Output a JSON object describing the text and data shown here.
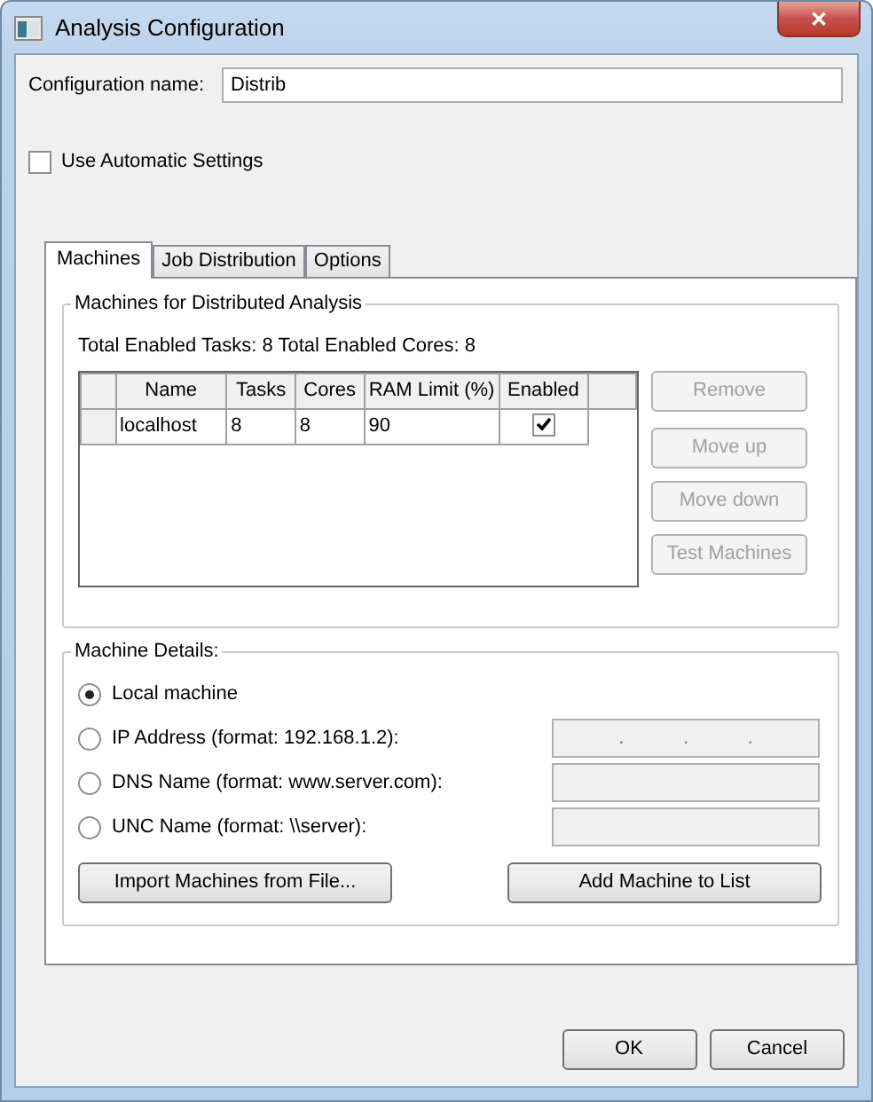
{
  "window": {
    "title": "Analysis Configuration",
    "close": "✕"
  },
  "config_name": {
    "label": "Configuration name:",
    "value": "Distrib"
  },
  "auto_settings": {
    "label": "Use Automatic Settings",
    "checked": false
  },
  "tabs": [
    {
      "label": "Machines",
      "selected": true
    },
    {
      "label": "Job Distribution",
      "selected": false
    },
    {
      "label": "Options",
      "selected": false
    }
  ],
  "machines_group": {
    "title": "Machines for Distributed Analysis",
    "totals": "Total Enabled Tasks: 8  Total Enabled Cores: 8",
    "table": {
      "columns": [
        "Name",
        "Tasks",
        "Cores",
        "RAM Limit (%)",
        "Enabled"
      ],
      "rows": [
        {
          "name": "localhost",
          "tasks": "8",
          "cores": "8",
          "ram_limit": "90",
          "enabled": true
        }
      ]
    },
    "buttons": [
      {
        "label": "Remove",
        "disabled": true
      },
      {
        "label": "Move up",
        "disabled": true
      },
      {
        "label": "Move down",
        "disabled": true
      },
      {
        "label": "Test Machines",
        "disabled": true
      }
    ]
  },
  "details_group": {
    "title": "Machine Details:",
    "options": [
      {
        "label": "Local machine",
        "selected": true,
        "kind": "plain"
      },
      {
        "label": "IP Address (format: 192.168.1.2):",
        "selected": false,
        "kind": "ip",
        "separator": "."
      },
      {
        "label": "DNS Name (format: www.server.com):",
        "selected": false,
        "kind": "text"
      },
      {
        "label": "UNC Name (format: \\\\server):",
        "selected": false,
        "kind": "text"
      }
    ],
    "buttons": [
      "Import Machines from File...",
      "Add Machine to List"
    ]
  },
  "footer_buttons": [
    "OK",
    "Cancel"
  ]
}
